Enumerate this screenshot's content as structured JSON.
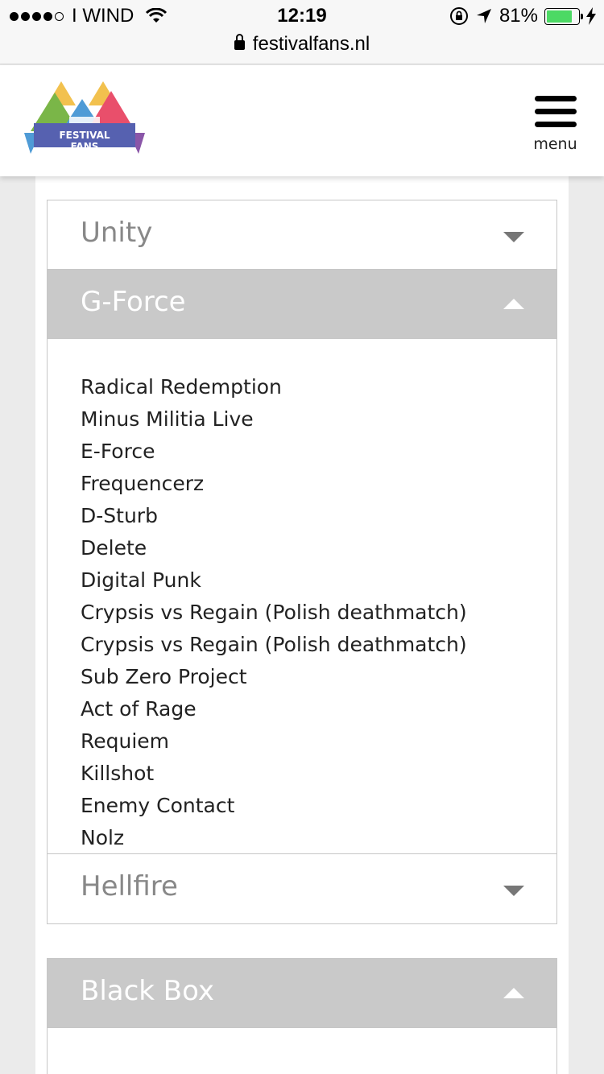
{
  "status_bar": {
    "carrier": "I WIND",
    "time": "12:19",
    "url": "festivalfans.nl",
    "battery_percent": "81%",
    "battery_level": 0.81
  },
  "header": {
    "logo_text": "FESTIVAL FANS",
    "menu_label": "menu"
  },
  "accordion": {
    "unity": {
      "title": "Unity"
    },
    "gforce": {
      "title": "G-Force",
      "artists": [
        "Radical Redemption",
        "Minus Militia Live",
        "E-Force",
        "Frequencerz",
        "D-Sturb",
        "Delete",
        "Digital Punk",
        "Crypsis vs Regain (Polish deathmatch)",
        "Crypsis vs Regain (Polish deathmatch)",
        "Sub Zero Project",
        "Act of Rage",
        "Requiem",
        "Killshot",
        "Enemy Contact",
        "Nolz"
      ]
    },
    "hellfire": {
      "title": "Hellfire"
    },
    "blackbox": {
      "title": "Black Box"
    }
  },
  "colors": {
    "open_header_bg": "#c9c9c9",
    "border": "#c6c6c6",
    "battery_green": "#4cd964"
  }
}
